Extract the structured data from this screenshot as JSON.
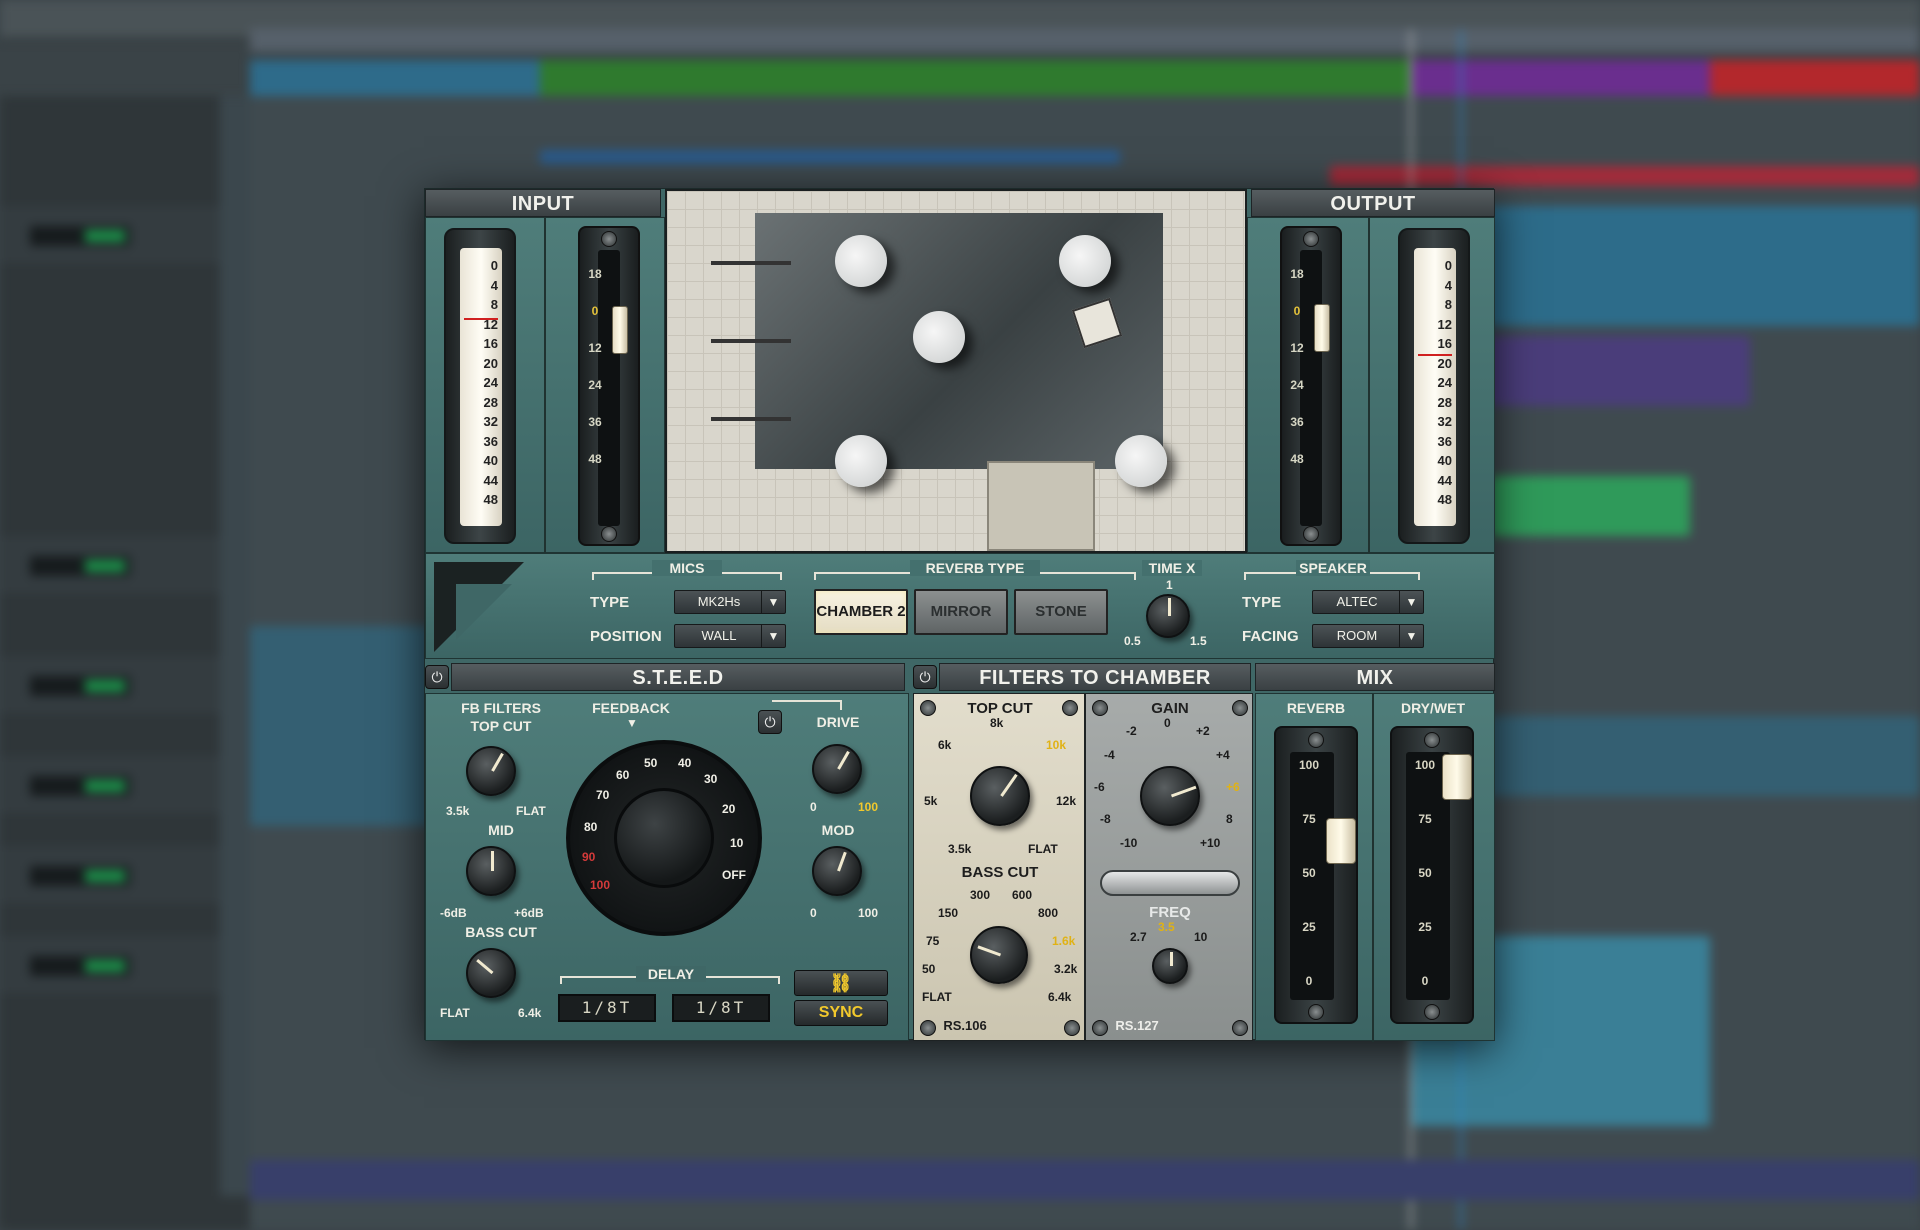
{
  "colors": {
    "accent_yellow": "#f2c92c",
    "panel_teal": "#3f6766",
    "meter_red": "#d02020"
  },
  "input": {
    "title": "INPUT"
  },
  "output": {
    "title": "OUTPUT"
  },
  "meter_scale": [
    "0",
    "4",
    "8",
    "12",
    "16",
    "20",
    "24",
    "28",
    "32",
    "36",
    "40",
    "44",
    "48"
  ],
  "trim_scale": [
    "18",
    "0",
    "12",
    "24",
    "36",
    "48"
  ],
  "mics": {
    "title": "MICS",
    "type_label": "TYPE",
    "type_value": "MK2Hs",
    "position_label": "POSITION",
    "position_value": "WALL"
  },
  "reverb_type": {
    "title": "REVERB TYPE",
    "options": [
      "CHAMBER 2",
      "MIRROR",
      "STONE"
    ],
    "selected": "CHAMBER 2"
  },
  "time_x": {
    "title": "TIME X",
    "min_label": "0.5",
    "max_label": "1.5",
    "top_label": "1"
  },
  "speaker": {
    "title": "SPEAKER",
    "type_label": "TYPE",
    "type_value": "ALTEC",
    "facing_label": "FACING",
    "facing_value": "ROOM"
  },
  "steed": {
    "title": "S.T.E.E.D",
    "fb_filters_label": "FB FILTERS",
    "top_cut_label": "TOP CUT",
    "top_cut_min": "3.5k",
    "top_cut_max": "FLAT",
    "mid_label": "MID",
    "mid_min": "-6dB",
    "mid_max": "+6dB",
    "bass_cut_label": "BASS CUT",
    "bass_cut_min": "FLAT",
    "bass_cut_max": "6.4k",
    "feedback_label": "FEEDBACK",
    "feedback_ticks": [
      "70",
      "60",
      "50",
      "40",
      "30",
      "20",
      "10",
      "OFF",
      "80",
      "90",
      "100"
    ],
    "drive_label": "DRIVE",
    "drive_min": "0",
    "drive_max": "100",
    "mod_label": "MOD",
    "mod_min": "0",
    "mod_max": "100",
    "delay_label": "DELAY",
    "delay_left": "1/8T",
    "delay_right": "1/8T",
    "link_icon": "link-icon",
    "sync_label": "SYNC"
  },
  "filters": {
    "title": "FILTERS TO CHAMBER",
    "top_cut_label": "TOP CUT",
    "top_cut_ticks": [
      "8k",
      "6k",
      "10k",
      "5k",
      "12k",
      "3.5k",
      "FLAT"
    ],
    "bass_cut_label": "BASS CUT",
    "bass_cut_ticks": [
      "300",
      "600",
      "150",
      "800",
      "75",
      "1.6k",
      "50",
      "3.2k",
      "FLAT",
      "6.4k"
    ],
    "model_left": "RS.106",
    "gain_label": "GAIN",
    "gain_ticks": [
      "0",
      "-2",
      "+2",
      "-4",
      "+4",
      "-6",
      "+6",
      "-8",
      "8",
      "-10",
      "+10"
    ],
    "freq_label": "FREQ",
    "freq_ticks": [
      "2.7",
      "3.5",
      "10"
    ],
    "model_right": "RS.127"
  },
  "mix": {
    "title": "MIX",
    "reverb_label": "REVERB",
    "drywet_label": "DRY/WET",
    "fader_scale": [
      "100",
      "75",
      "50",
      "25",
      "0"
    ]
  }
}
